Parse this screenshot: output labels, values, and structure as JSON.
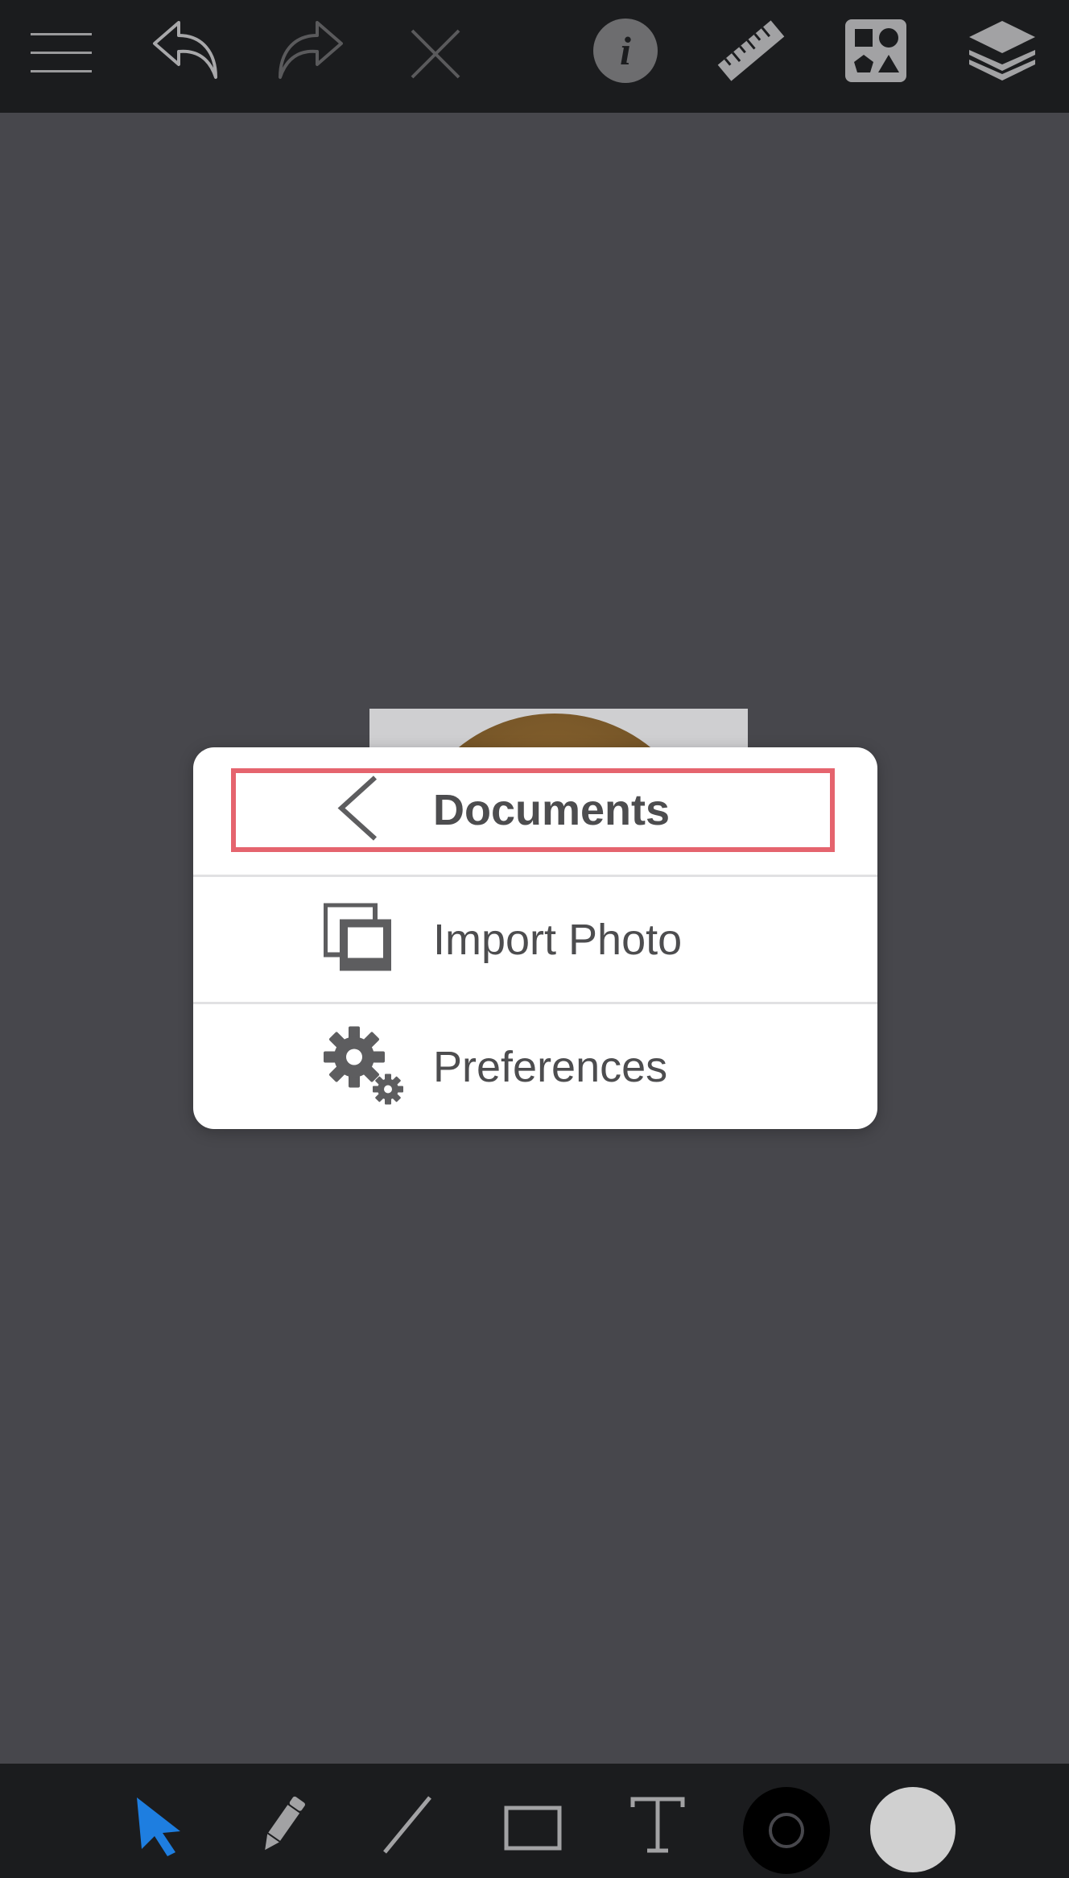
{
  "top_bar": {
    "icons": [
      "menu-icon",
      "undo-icon",
      "redo-icon",
      "close-icon",
      "info-icon",
      "ruler-icon",
      "shapes-icon",
      "layers-icon"
    ]
  },
  "menu": {
    "items": [
      {
        "label": "Documents",
        "icon": "chevron-left-icon"
      },
      {
        "label": "Import Photo",
        "icon": "photos-icon"
      },
      {
        "label": "Preferences",
        "icon": "gears-icon"
      }
    ]
  },
  "bottom_bar": {
    "tools": [
      "select-arrow-icon",
      "pencil-icon",
      "line-icon",
      "rectangle-icon",
      "text-icon",
      "stroke-color",
      "fill-color"
    ],
    "colors": {
      "select_active": "#1e7ee0",
      "stroke": "#000000",
      "fill": "#d0d0d0",
      "highlight": "#e5646e"
    }
  }
}
